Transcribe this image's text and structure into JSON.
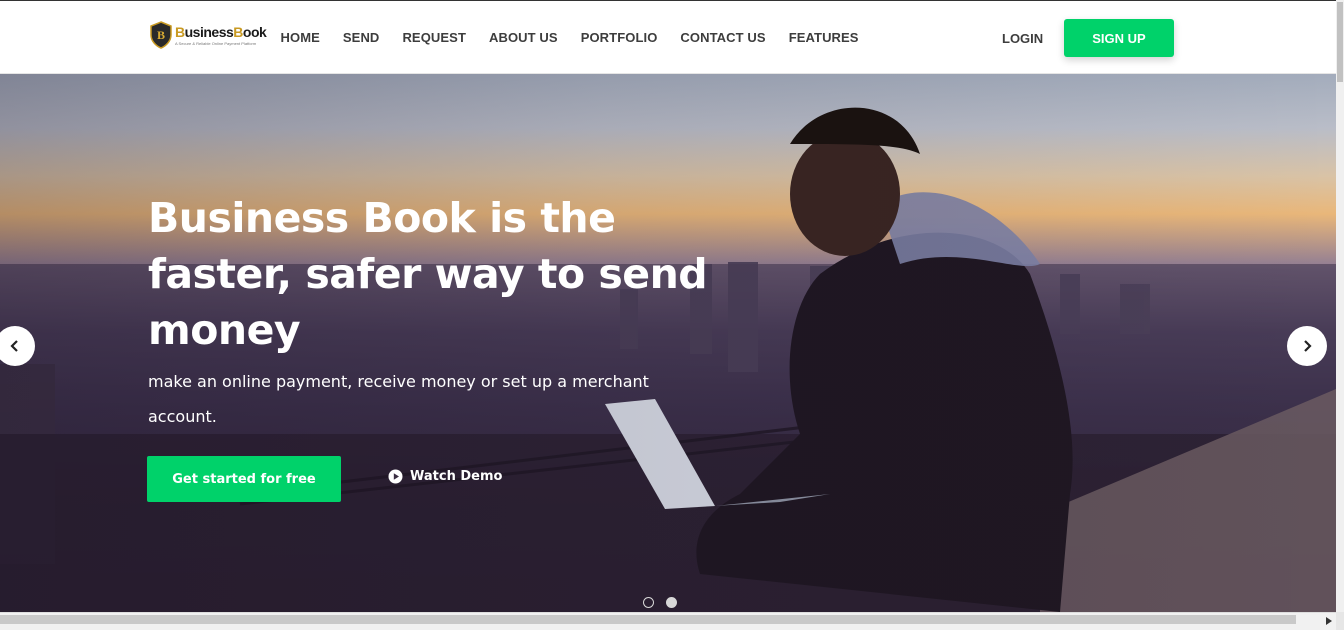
{
  "brand": {
    "name_part1": "B",
    "name_part2": "usiness",
    "name_part3": "B",
    "name_part4": "ook",
    "tagline": "A Secure & Reliable Online Payment Platform",
    "shield_letter": "B"
  },
  "nav": {
    "items": [
      "HOME",
      "SEND",
      "REQUEST",
      "ABOUT US",
      "PORTFOLIO",
      "CONTACT US",
      "FEATURES"
    ],
    "login_label": "LOGIN",
    "signup_label": "SIGN UP"
  },
  "hero": {
    "title": "Business Book is the faster, safer way to send money",
    "subtitle": "make an online payment, receive money or set up a merchant account.",
    "cta_label": "Get started for free",
    "watch_label": "Watch Demo",
    "slides": {
      "count": 2,
      "active_index": 1
    }
  },
  "icons": {
    "prev": "chevron-left-icon",
    "next": "chevron-right-icon",
    "play": "play-circle-icon",
    "logo": "shield-logo-icon"
  },
  "colors": {
    "accent": "#00d26a",
    "nav_text": "#3d3d3d",
    "brand_gold": "#c99a22"
  }
}
